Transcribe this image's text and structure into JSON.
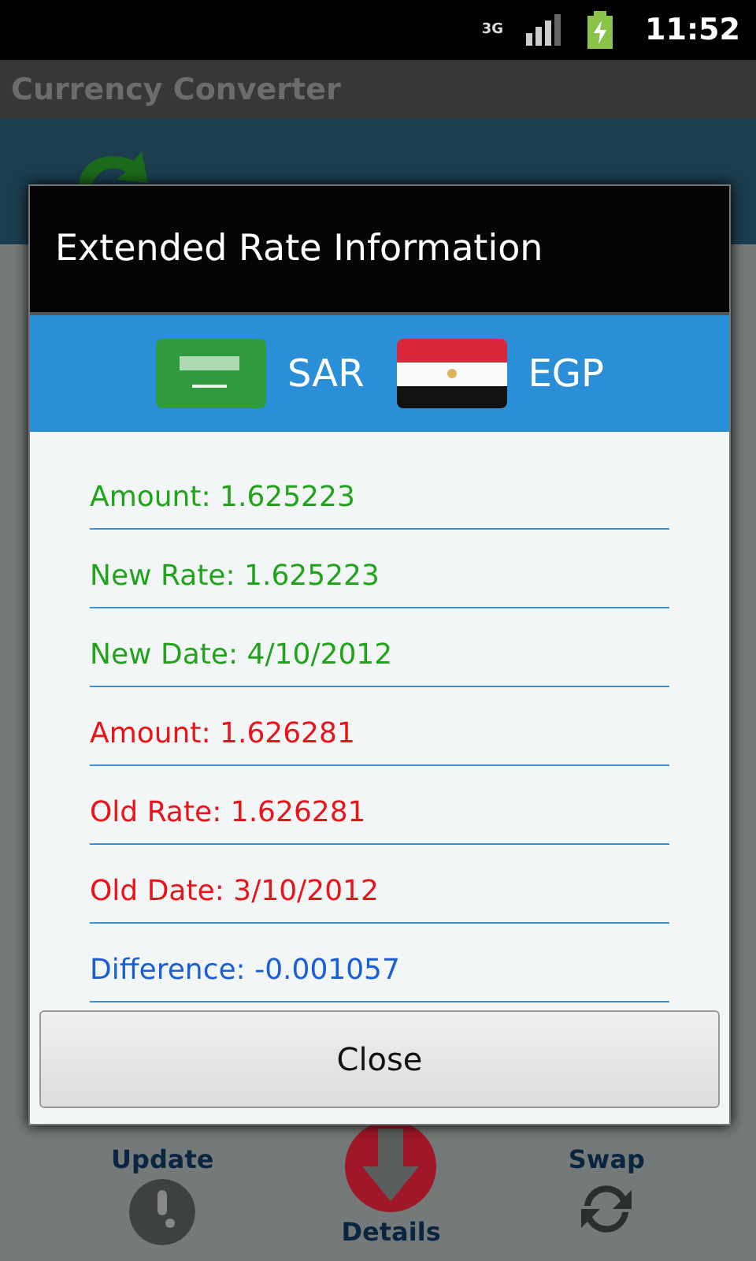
{
  "status_bar": {
    "network": "3G",
    "time": "11:52"
  },
  "app": {
    "title": "Currency Converter"
  },
  "dialog": {
    "title": "Extended Rate Information",
    "currencies": [
      {
        "code": "SAR",
        "kind": "sa"
      },
      {
        "code": "EGP",
        "kind": "eg"
      }
    ],
    "rows": [
      {
        "text": "Amount: 1.625223",
        "color": "#22a31c"
      },
      {
        "text": "New Rate: 1.625223",
        "color": "#22a31c"
      },
      {
        "text": "New Date: 4/10/2012",
        "color": "#22a31c"
      },
      {
        "text": "Amount: 1.626281",
        "color": "#e8141a"
      },
      {
        "text": "Old Rate: 1.626281",
        "color": "#e8141a"
      },
      {
        "text": "Old Date: 3/10/2012",
        "color": "#e8141a"
      },
      {
        "text": "Difference: -0.001057",
        "color": "#1a5fd6"
      }
    ],
    "button": "Close"
  },
  "actions": [
    {
      "label": "Update",
      "kind": "update"
    },
    {
      "label": "Details",
      "kind": "details"
    },
    {
      "label": "Swap",
      "kind": "swap"
    }
  ]
}
